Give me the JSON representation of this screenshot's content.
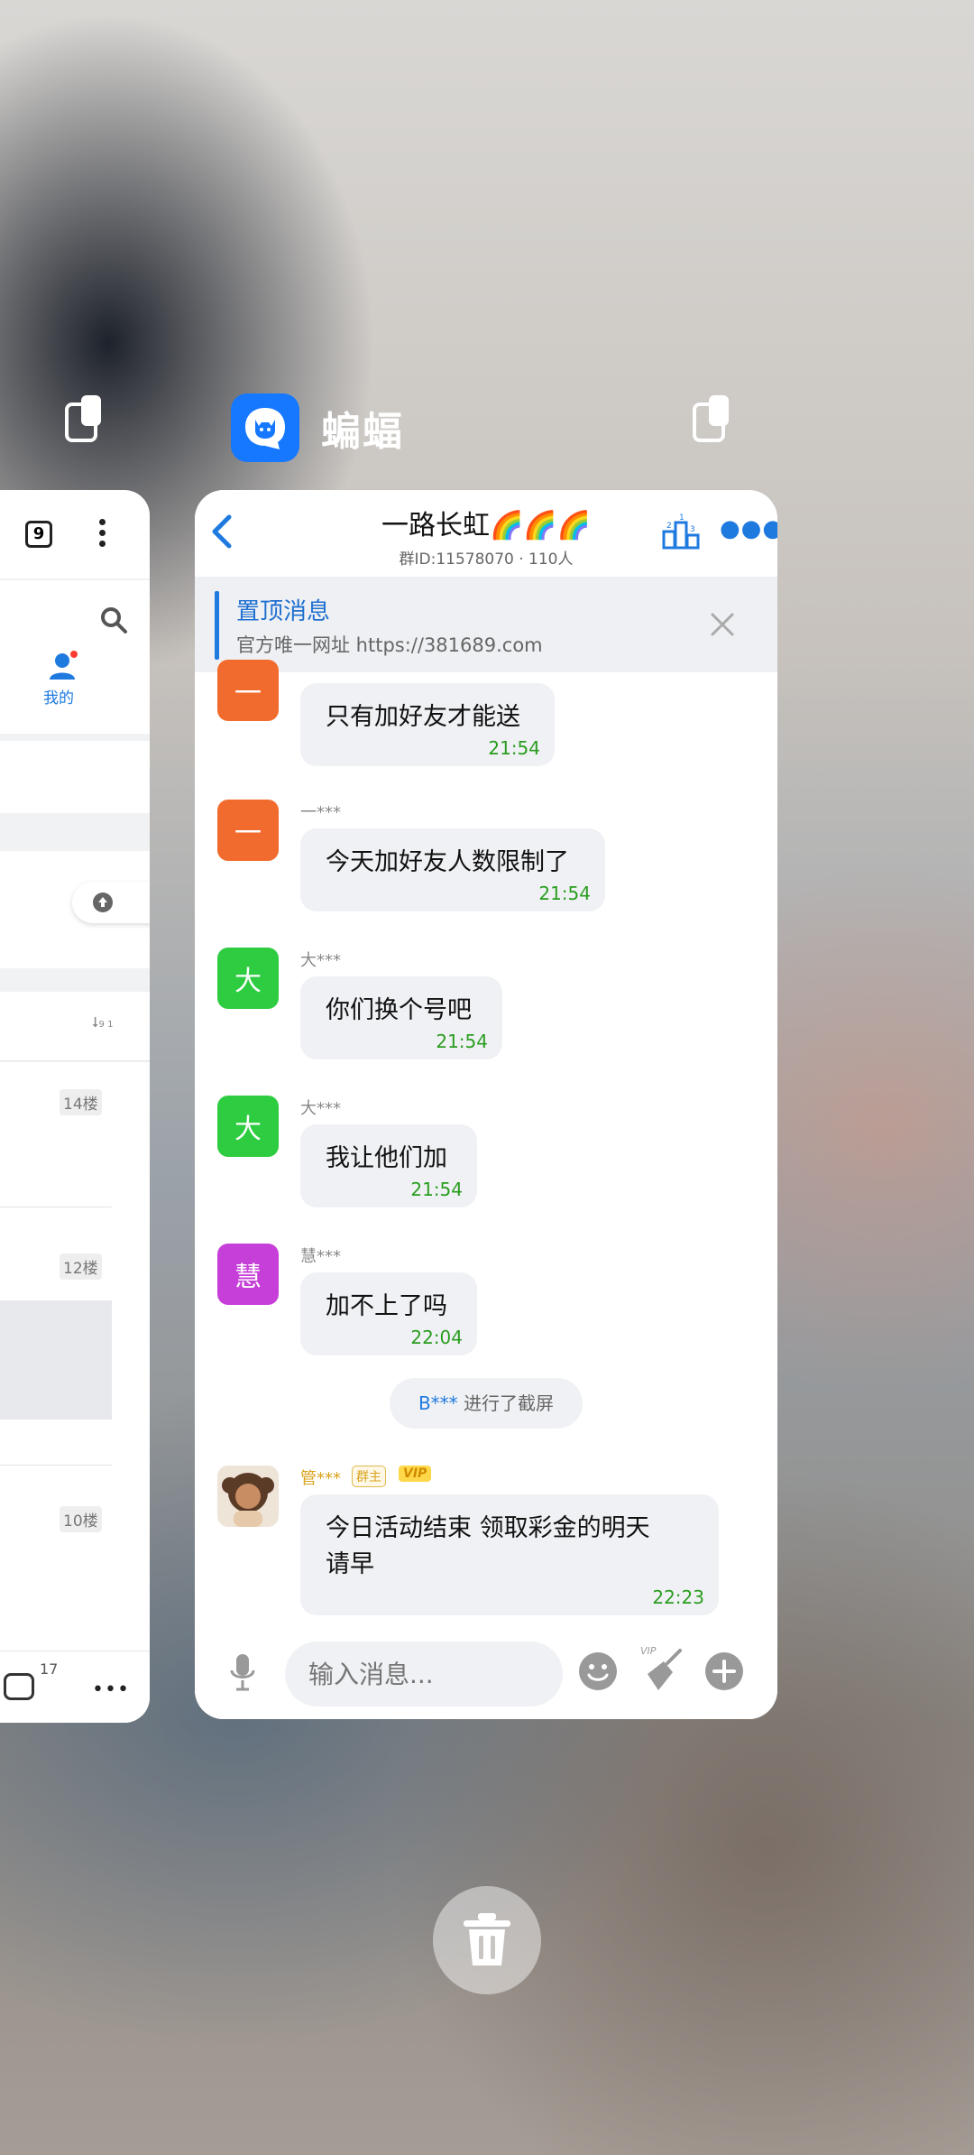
{
  "recents": {
    "app_name": "蝙蝠"
  },
  "left_card": {
    "tab_count": "9",
    "profile_label": "我的",
    "floors": [
      "14楼",
      "12楼",
      "10楼"
    ],
    "sort_badge": "9 1",
    "comment_count": "17"
  },
  "chat": {
    "group_title": "一路长虹🌈🌈🌈",
    "group_meta": "群ID:11578070 · 110人",
    "pinned_title": "置顶消息",
    "pinned_text": "官方唯一网址 https://381689.com",
    "messages": [
      {
        "avatar": "一",
        "sender": "",
        "text": "只有加好友才能送",
        "time": "21:54"
      },
      {
        "avatar": "一",
        "sender": "一***",
        "text": "今天加好友人数限制了",
        "time": "21:54"
      },
      {
        "avatar": "大",
        "sender": "大***",
        "text": "你们换个号吧",
        "time": "21:54"
      },
      {
        "avatar": "大",
        "sender": "大***",
        "text": "我让他们加",
        "time": "21:54"
      },
      {
        "avatar": "慧",
        "sender": "慧***",
        "text": "加不上了吗",
        "time": "22:04"
      },
      {
        "avatar": "",
        "sender": "管***",
        "role_badge": "群主",
        "vip_badge": "VIP",
        "text_line1": "今日活动结束  领取彩金的明天",
        "text_line2": "请早",
        "time": "22:23"
      }
    ],
    "system_name": "B***",
    "system_text": " 进行了截屏",
    "input_placeholder": "输入消息...",
    "vip_label": "VIP"
  },
  "colors": {
    "accent": "#1f7ae0",
    "time_green": "#2a9d20",
    "avatar_orange": "#f26b2e",
    "avatar_green": "#2ecc40",
    "avatar_purple": "#c63fd8",
    "app_blue": "#1677ff"
  }
}
